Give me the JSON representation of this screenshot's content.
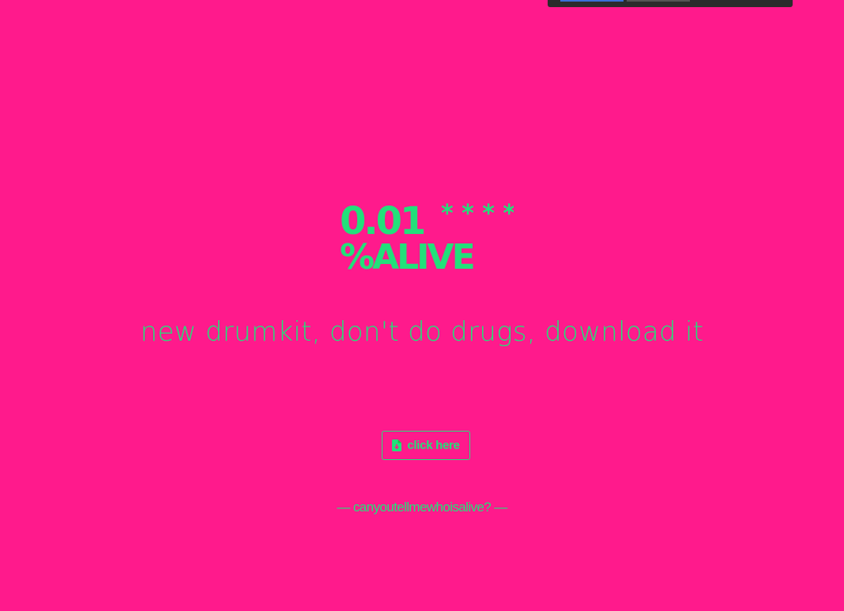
{
  "logo": {
    "line1": "0.01",
    "stars": "* * * *",
    "line2": "%ALIVE",
    "icon": "logo-wordmark"
  },
  "tagline": "new drumkit, don't do drugs, download it",
  "download_button": {
    "label": "click here",
    "icon": "file-download-icon"
  },
  "footer": {
    "quote": "— canyoutellmewhoisalive? —"
  },
  "colors": {
    "background": "#ff1a8c",
    "accent": "#22e07a",
    "accent_dark": "#1fbf4a"
  }
}
